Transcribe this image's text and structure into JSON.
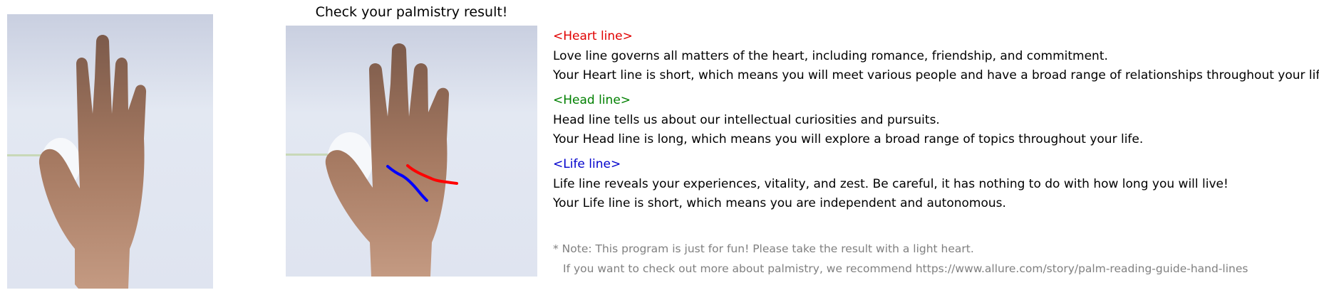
{
  "header": {
    "title": "Check your palmistry result!"
  },
  "images": {
    "original": {
      "label": "original-hand-photo"
    },
    "annotated": {
      "label": "annotated-hand-photo"
    }
  },
  "lines": {
    "heart": {
      "heading": "<Heart line>",
      "color": "#e00000",
      "description": "Love line governs all matters of the heart, including romance, friendship, and commitment.",
      "result": "Your Heart line is short, which means you will meet various people and have a broad range of relationships throughout your life."
    },
    "head": {
      "heading": "<Head line>",
      "color": "#008000",
      "description": "Head line tells us about our intellectual curiosities and pursuits.",
      "result": "Your Head line is long, which means you will explore a broad range of topics throughout your life."
    },
    "life": {
      "heading": "<Life line>",
      "color": "#0000cc",
      "description": "Life line reveals your experiences, vitality, and zest. Be careful, it has nothing to do with how long you will live!",
      "result": "Your Life line is short, which means you are independent and autonomous."
    }
  },
  "note": {
    "line1": "* Note: This program is just for fun! Please take the result with a light heart.",
    "line2": "If you want to check out more about palmistry, we recommend https://www.allure.com/story/palm-reading-guide-hand-lines"
  }
}
